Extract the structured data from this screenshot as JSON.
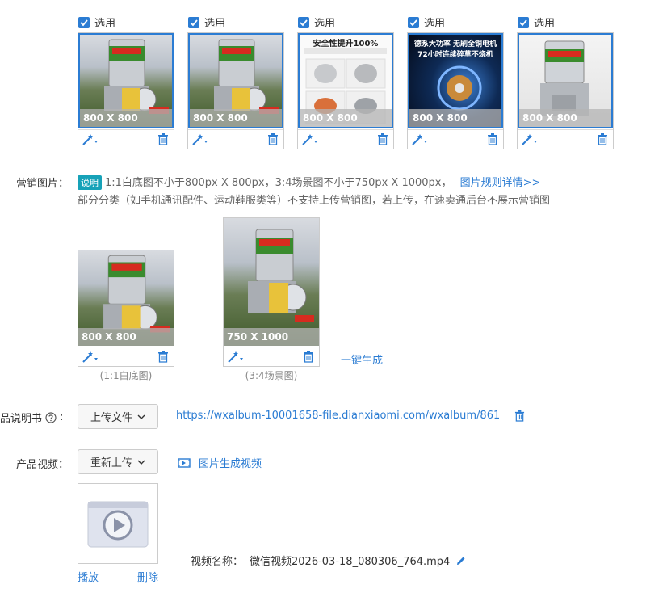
{
  "checkbox_label": "选用",
  "main_images": [
    {
      "dim": "800 X 800",
      "style": "farm"
    },
    {
      "dim": "800 X 800",
      "style": "farm"
    },
    {
      "dim": "800 X 800",
      "style": "white",
      "headline": "安全性提升100%"
    },
    {
      "dim": "800 X 800",
      "style": "dark",
      "headline": "德系大功率 无刷全铜电机",
      "headline2": "72小时连续碎草不烧机"
    },
    {
      "dim": "800 X 800",
      "style": "grey"
    }
  ],
  "marketing": {
    "label": "营销图片：",
    "badge": "说明",
    "rule_text": "1:1白底图不小于800px X 800px，3:4场景图不小于750px X 1000px，",
    "rule_link": "图片规则详情>>",
    "note": "部分分类（如手机通讯配件、运动鞋服类等）不支持上传营销图，若上传，在速卖通后台不展示营销图",
    "square": {
      "dim": "800 X 800",
      "caption": "(1:1白底图)"
    },
    "portrait": {
      "dim": "750 X 1000",
      "caption": "(3:4场景图)"
    },
    "generate_link": "一键生成"
  },
  "manual": {
    "label": "品说明书",
    "button": "上传文件",
    "file_url": "https://wxalbum-10001658-file.dianxiaomi.com/wxalbum/861265/2..."
  },
  "video": {
    "label": "产品视频：",
    "button": "重新上传",
    "gen_link": "图片生成视频",
    "name_label": "视频名称：",
    "name_value": "微信视频2026-03-18_080306_764.mp4",
    "play": "播放",
    "delete": "删除"
  },
  "colors": {
    "accent": "#2b7cd3",
    "badge": "#17a2b8"
  }
}
